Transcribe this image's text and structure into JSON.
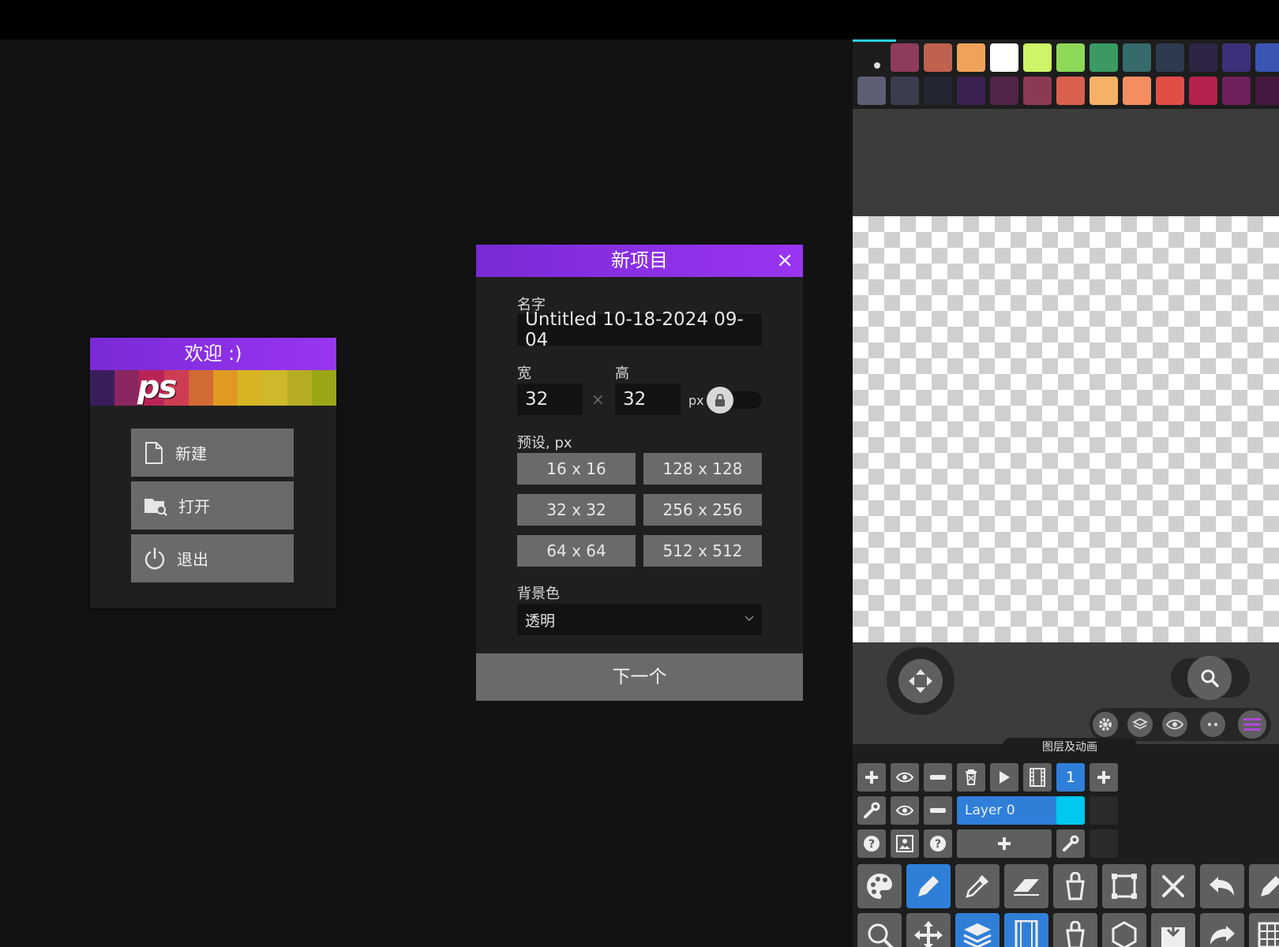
{
  "welcome": {
    "title": "欢迎 :)",
    "logo_text": "ps",
    "buttons": [
      {
        "label": "新建",
        "icon": "file-icon"
      },
      {
        "label": "打开",
        "icon": "folder-search-icon"
      },
      {
        "label": "退出",
        "icon": "power-icon"
      }
    ]
  },
  "new_project": {
    "title": "新项目",
    "close_glyph": "×",
    "name_label": "名字",
    "name_value": "Untitled 10-18-2024 09-04",
    "width_label": "宽",
    "height_label": "高",
    "width_value": "32",
    "height_value": "32",
    "times_glyph": "×",
    "unit": "px",
    "presets_label": "预设, px",
    "presets": [
      "16 x 16",
      "128 x 128",
      "32 x 32",
      "256 x 256",
      "64 x 64",
      "512 x 512"
    ],
    "bg_label": "背景色",
    "bg_value": "透明",
    "next_label": "下一个"
  },
  "right_panel": {
    "palette_row1": [
      "#8f3b5c",
      "#c0614f",
      "#f0a25a",
      "#ffffff",
      "#cdf567",
      "#8ed858",
      "#3a9a62",
      "#356c6b",
      "#2c3b50",
      "#2e2544",
      "#3e2f7a",
      "#3b55b3"
    ],
    "palette_row2": [
      "#5c5e73",
      "#3a3d4d",
      "#232633",
      "#3b2252",
      "#522448",
      "#8c3a53",
      "#d9604e",
      "#f5b167",
      "#f48e5e",
      "#e04e45",
      "#b5214d",
      "#6f1f5c",
      "#46183f"
    ],
    "layers_title": "图层及动画",
    "frame_number": "1",
    "layer_name": "Layer 0",
    "layer_color": "#00c8f0"
  }
}
